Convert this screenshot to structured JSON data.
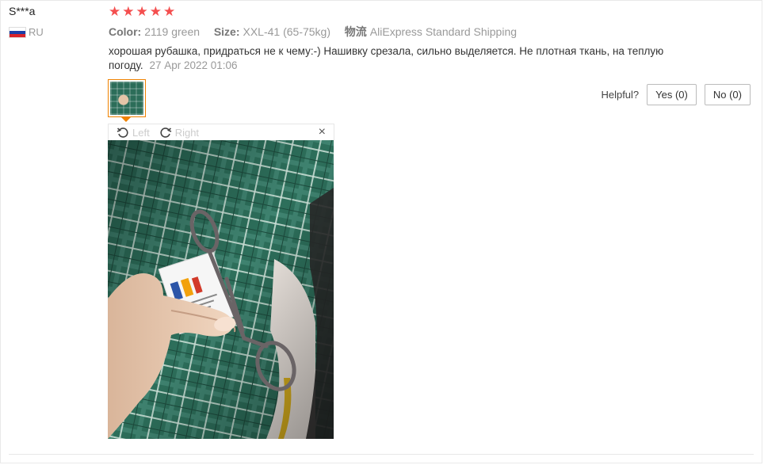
{
  "user": {
    "name": "S***a",
    "country": "RU"
  },
  "rating": {
    "stars": 5,
    "max": 5,
    "color": "#f44f4f"
  },
  "attributes": {
    "color_label": "Color:",
    "color_value": "2119 green",
    "size_label": "Size:",
    "size_value": "XXL-41 (65-75kg)",
    "shipping_label": "物流",
    "shipping_value": "AliExpress Standard Shipping"
  },
  "review": {
    "text": "хорошая рубашка, придраться не к чему:-) Нашивку срезала, сильно выделяется. Не плотная ткань, на теплую погоду.",
    "date": "27 Apr 2022 01:06"
  },
  "helpful": {
    "label": "Helpful?",
    "yes": "Yes (0)",
    "no": "No (0)"
  },
  "viewer": {
    "rotate_left": "Left",
    "rotate_right": "Right",
    "close": "×"
  },
  "colors": {
    "accent": "#f08200",
    "shirt_green": "#2c6d59"
  }
}
